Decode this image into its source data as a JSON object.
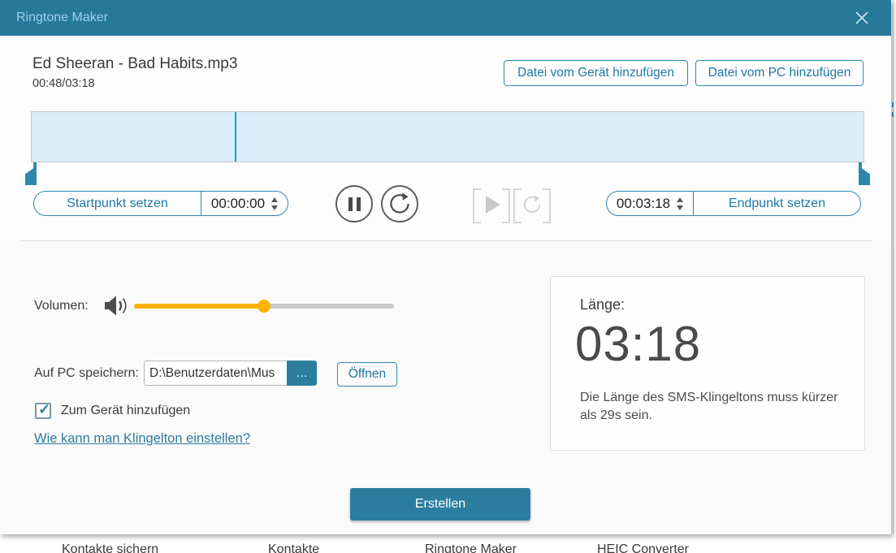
{
  "window": {
    "title": "Ringtone Maker"
  },
  "header": {
    "song_title": "Ed Sheeran - Bad Habits.mp3",
    "playback_time": "00:48/03:18",
    "add_from_device": "Datei vom Gerät hinzufügen",
    "add_from_pc": "Datei vom PC hinzufügen"
  },
  "trimmer": {
    "playhead_percent": 24.4,
    "start": {
      "button": "Startpunkt setzen",
      "value": "00:00:00"
    },
    "end": {
      "value": "00:03:18",
      "button": "Endpunkt setzen"
    }
  },
  "volume": {
    "label": "Volumen:",
    "percent": 50
  },
  "save": {
    "label": "Auf PC speichern:",
    "path": "D:\\Benutzerdaten\\Mus",
    "browse_label": "…",
    "open_button": "Öffnen"
  },
  "options": {
    "add_to_device": "Zum Gerät hinzufügen",
    "checked": true,
    "checkmark": "✓",
    "help_link": "Wie kann man Klingelton einstellen?"
  },
  "length_panel": {
    "label": "Länge:",
    "value": "03:18",
    "hint": "Die Länge des SMS-Klingeltons muss kürzer als 29s sein."
  },
  "actions": {
    "create": "Erstellen"
  },
  "background_window": {
    "nav_items": [
      "Kontakte sichern",
      "Kontakte",
      "Ringtone Maker",
      "HEIC Converter"
    ]
  },
  "colors": {
    "accent": "#2b7e9f",
    "titlebar": "#28789a",
    "wave_background": "#d8eefa",
    "playhead": "#17a0c6",
    "slider_fill": "#ffb200"
  }
}
